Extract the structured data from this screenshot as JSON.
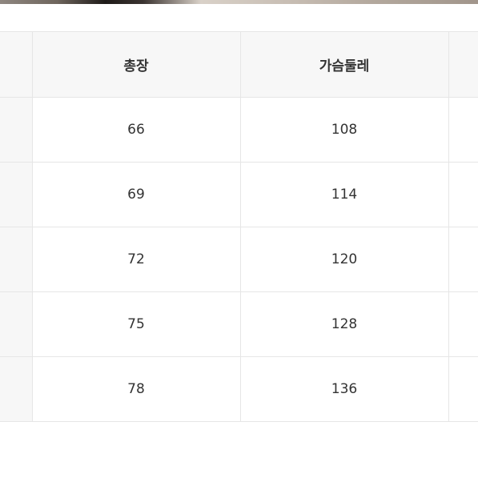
{
  "table": {
    "headers": {
      "total_length": "총장",
      "chest": "가슴둘레"
    },
    "rows": [
      {
        "total_length": "66",
        "chest": "108"
      },
      {
        "total_length": "69",
        "chest": "114"
      },
      {
        "total_length": "72",
        "chest": "120"
      },
      {
        "total_length": "75",
        "chest": "128"
      },
      {
        "total_length": "78",
        "chest": "136"
      }
    ]
  }
}
